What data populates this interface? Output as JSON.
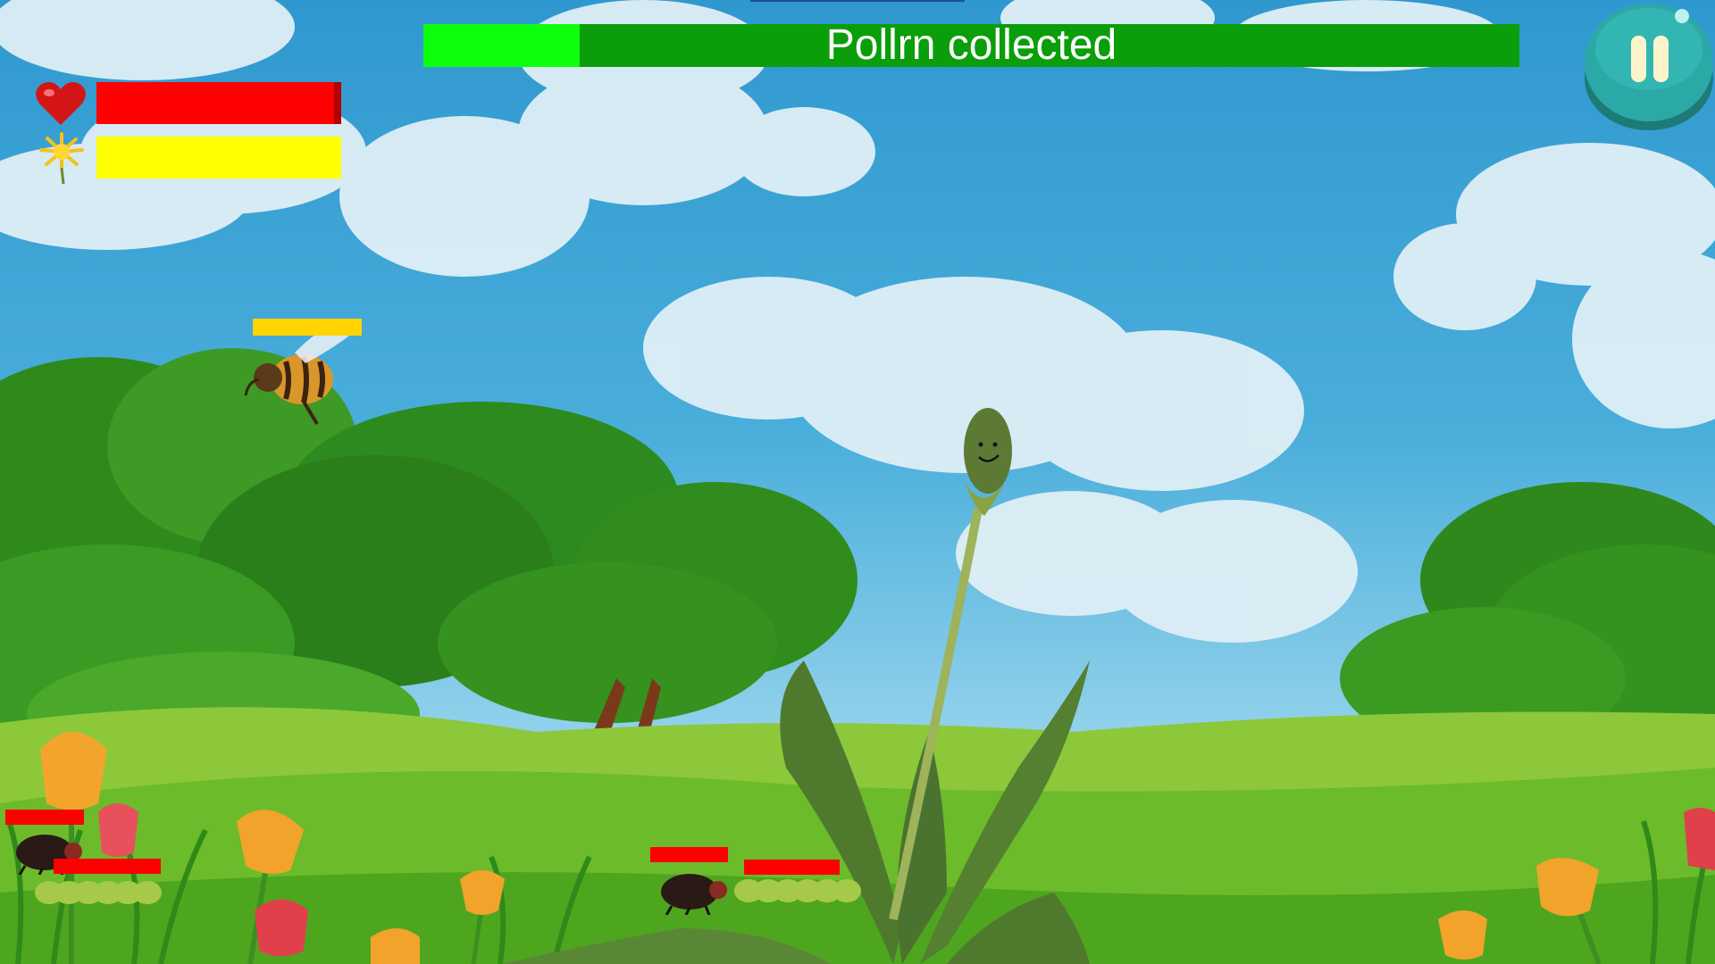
{
  "hud": {
    "progress_label": "Pollrn collected",
    "progress_fraction": 0.143,
    "health_fraction": 0.97,
    "pollen_fraction": 1.0,
    "health_icon": "heart-icon",
    "pollen_icon": "dandelion-flower-icon",
    "pause_icon": "pause-icon"
  },
  "bee": {
    "health_fraction": 1.0
  },
  "enemies": [
    {
      "kind": "beetle",
      "health_fraction": 1.0
    },
    {
      "kind": "caterpillar",
      "health_fraction": 1.0
    },
    {
      "kind": "beetle",
      "health_fraction": 1.0
    },
    {
      "kind": "caterpillar",
      "health_fraction": 1.0
    }
  ],
  "colors": {
    "progress_track": "#0a9e0a",
    "progress_fill": "#0cff0c",
    "health": "#ff0000",
    "pollen": "#ffff00",
    "pause_button": "#2ba9a6"
  }
}
